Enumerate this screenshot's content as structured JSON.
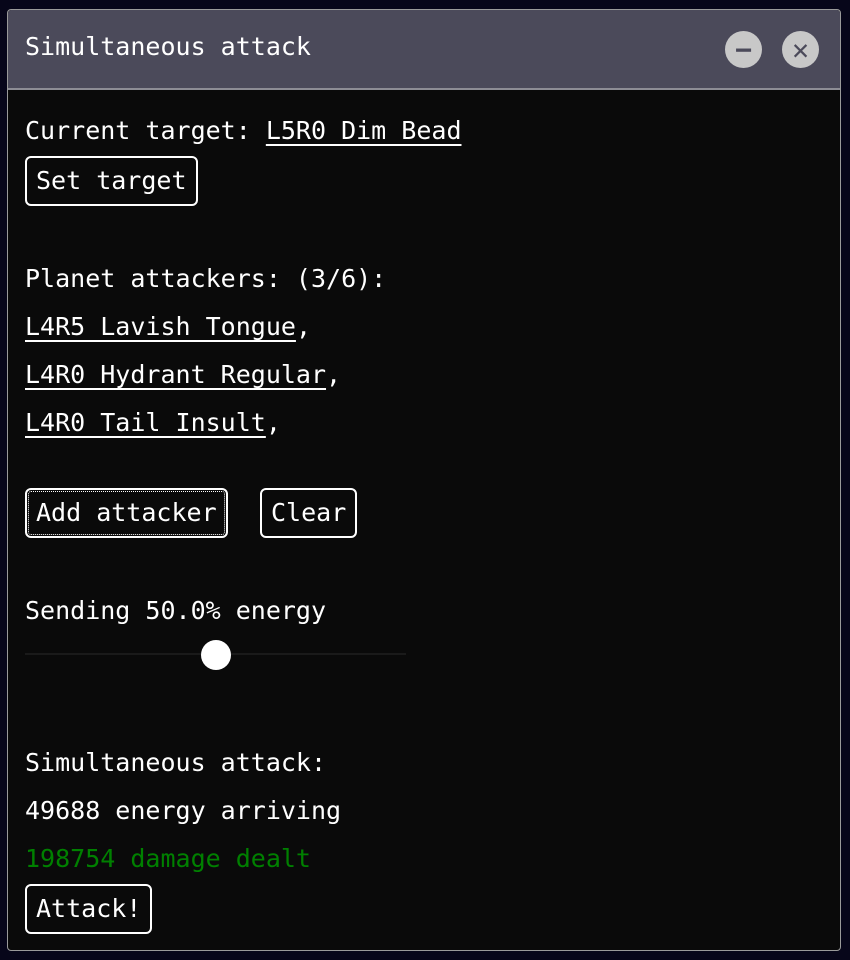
{
  "window": {
    "title": "Simultaneous attack",
    "minimize_icon": "minus-circle-icon",
    "close_icon": "x-circle-icon"
  },
  "target": {
    "label": "Current target: ",
    "name": "L5R0 Dim Bead",
    "set_button": "Set target"
  },
  "attackers": {
    "label": "Planet attackers: (3/6):",
    "items": [
      {
        "name": "L4R5 Lavish Tongue",
        "sep": ","
      },
      {
        "name": "L4R0 Hydrant Regular",
        "sep": ","
      },
      {
        "name": "L4R0 Tail Insult",
        "sep": ","
      }
    ],
    "add_button": "Add attacker",
    "clear_button": "Clear"
  },
  "energy": {
    "label": "Sending 50.0% energy",
    "percent": 50
  },
  "summary": {
    "heading": "Simultaneous attack:",
    "arriving": "49688 energy arriving",
    "damage": "198754 damage dealt",
    "damage_color": "#008000",
    "attack_button": "Attack!"
  }
}
